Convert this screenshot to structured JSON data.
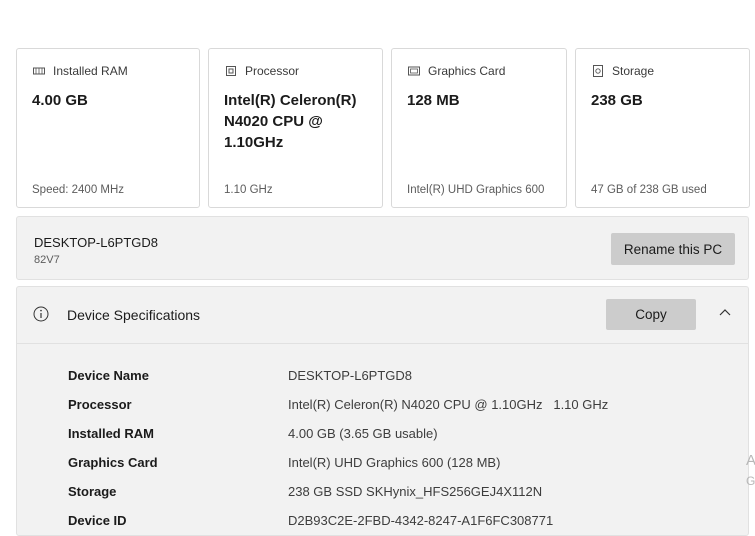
{
  "cards": [
    {
      "title": "Installed RAM",
      "icon": "ram-icon",
      "value": "4.00 GB",
      "footer": "Speed: 2400 MHz"
    },
    {
      "title": "Processor",
      "icon": "processor-icon",
      "value": "Intel(R) Celeron(R) N4020 CPU @ 1.10GHz",
      "footer": "1.10 GHz"
    },
    {
      "title": "Graphics Card",
      "icon": "graphics-card-icon",
      "value": "128 MB",
      "footer": "Intel(R) UHD Graphics 600"
    },
    {
      "title": "Storage",
      "icon": "storage-icon",
      "value": "238 GB",
      "footer": "47 GB of 238 GB used"
    }
  ],
  "pc": {
    "name": "DESKTOP-L6PTGD8",
    "model": "82V7",
    "rename_label": "Rename this PC"
  },
  "specs": {
    "title": "Device Specifications",
    "copy_label": "Copy",
    "rows": [
      {
        "label": "Device Name",
        "value": "DESKTOP-L6PTGD8"
      },
      {
        "label": "Processor",
        "value": "Intel(R) Celeron(R) N4020 CPU @ 1.10GHz   1.10 GHz"
      },
      {
        "label": "Installed RAM",
        "value": "4.00 GB (3.65 GB usable)"
      },
      {
        "label": "Graphics Card",
        "value": "Intel(R) UHD Graphics 600 (128 MB)"
      },
      {
        "label": "Storage",
        "value": "238 GB SSD SKHynix_HFS256GEJ4X112N"
      },
      {
        "label": "Device ID",
        "value": "D2B93C2E-2FBD-4342-8247-A1F6FC308771"
      }
    ]
  },
  "watermark": {
    "line1": "A",
    "line2": "G"
  }
}
